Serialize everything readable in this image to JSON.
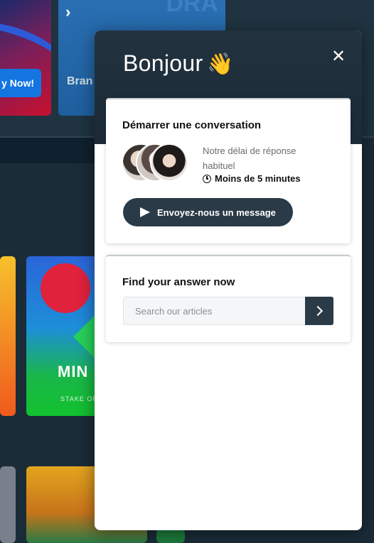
{
  "background": {
    "promo_button_label": "y Now!",
    "promo_card_text": "Bran",
    "promo_card_big_text": "DRA",
    "game_tile_label": "MIN",
    "game_tile_sub": "STAKE ORIG"
  },
  "widget": {
    "greeting": "Bonjour",
    "greeting_emoji": "👋",
    "close_icon": "close-icon",
    "conversation_card": {
      "title": "Démarrer une conversation",
      "response_label": "Notre délai de réponse habituel",
      "response_time": "Moins de 5 minutes",
      "send_button_label": "Envoyez-nous un message"
    },
    "help_card": {
      "title": "Find your answer now",
      "search_placeholder": "Search our articles"
    }
  },
  "colors": {
    "header_bg": "#1b2a36",
    "button_bg": "#2b3a47",
    "page_bg": "#1a2c38"
  }
}
